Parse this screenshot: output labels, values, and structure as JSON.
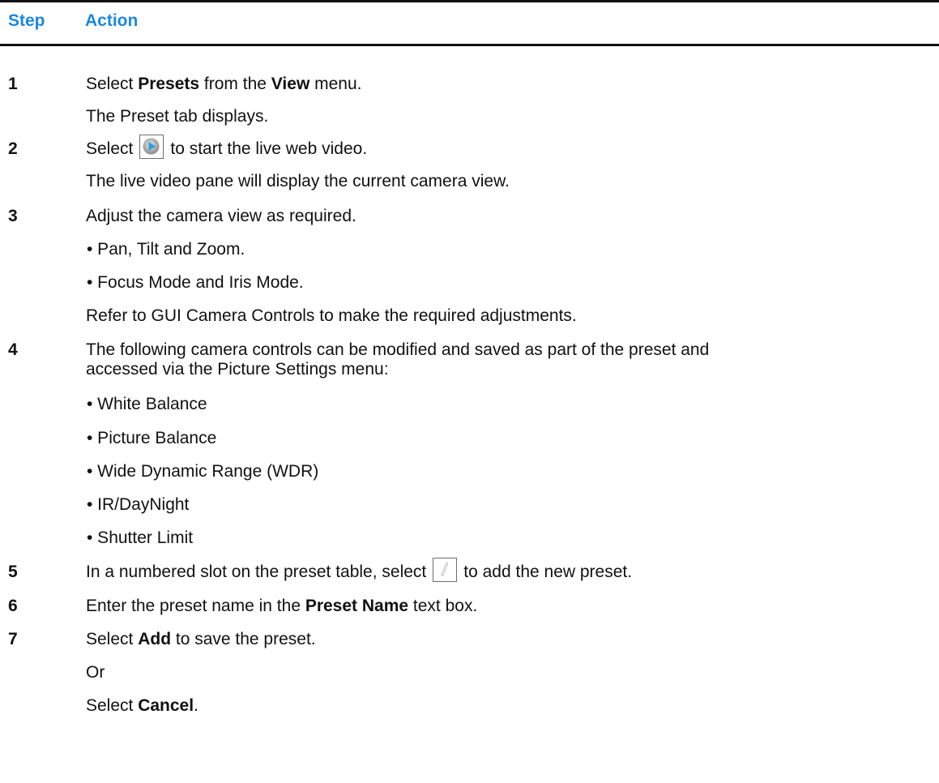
{
  "table": {
    "header": {
      "step": "Step",
      "action": "Action"
    },
    "steps": [
      {
        "number": "1",
        "lines": [
          {
            "pre": "Select ",
            "b1": "Presets",
            "mid": " from the ",
            "b2": "View",
            "post": " menu."
          },
          {
            "text": "The Preset tab displays."
          }
        ]
      },
      {
        "number": "2",
        "lines": [
          {
            "pre": "Select",
            "icon": "play-icon",
            "post": "to start the live web video."
          },
          {
            "text": "The live video pane will display the current camera view."
          }
        ]
      },
      {
        "number": "3",
        "lines": [
          {
            "text": "Adjust the camera view as required."
          },
          {
            "bullet": "• Pan, Tilt and Zoom."
          },
          {
            "bullet": "• Focus Mode and Iris Mode."
          },
          {
            "text": "Refer to  GUI Camera Controls to make the required adjustments."
          }
        ]
      },
      {
        "number": "4",
        "lines": [
          {
            "text": "The following camera controls can be modified and saved as part of the preset and"
          },
          {
            "text": "accessed via the Picture Settings menu:"
          },
          {
            "bullet": "• White Balance"
          },
          {
            "bullet": "• Picture Balance"
          },
          {
            "bullet": "• Wide Dynamic Range (WDR)"
          },
          {
            "bullet": "• IR/DayNight"
          },
          {
            "bullet": "• Shutter Limit"
          }
        ]
      },
      {
        "number": "5",
        "lines": [
          {
            "pre": "In a numbered slot on the preset table, select",
            "icon": "pencil-icon",
            "post": "to add the new preset."
          }
        ]
      },
      {
        "number": "6",
        "lines": [
          {
            "pre": "Enter the preset name in the ",
            "b1": "Preset Name",
            "post": " text box."
          }
        ]
      },
      {
        "number": "7",
        "lines": [
          {
            "pre": "Select ",
            "b1": "Add",
            "post": " to save the preset."
          },
          {
            "text": "Or"
          },
          {
            "pre": "Select ",
            "b1": "Cancel",
            "post": "."
          }
        ]
      }
    ]
  },
  "colors": {
    "header_text": "#1e88d6",
    "rule": "#111111"
  }
}
